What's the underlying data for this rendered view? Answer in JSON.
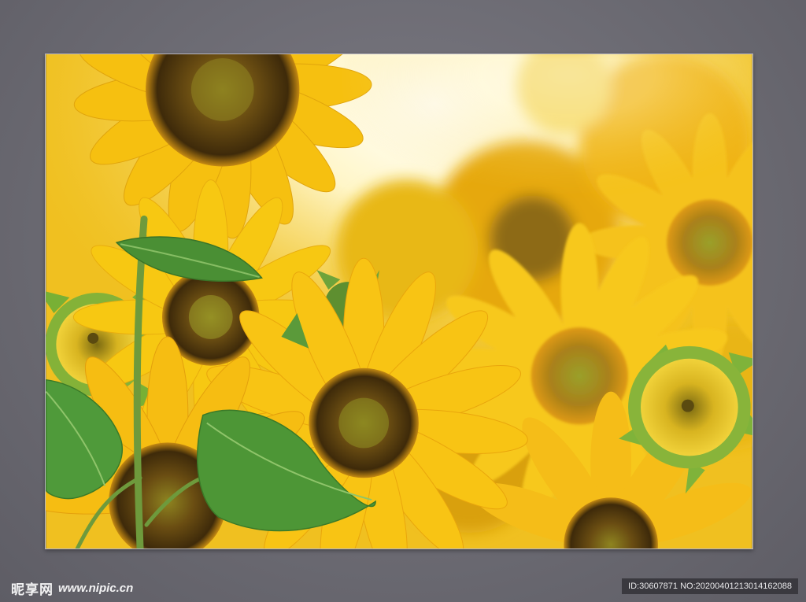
{
  "scene": {
    "subject": "sunflower-field-photo",
    "colors": {
      "background": "#6c6b73",
      "petal": "#f5c61a",
      "petal_deep": "#f0a80c",
      "seed_disc": "#6b4a12",
      "seed_center": "#8d7a20",
      "leaf": "#4f9a3a",
      "sky_glow": "#ffffff"
    }
  },
  "watermark": {
    "logo_text": "昵享网",
    "site_url": "www.nipic.cn",
    "id_text": "ID:30607871 NO:20200401213014162088"
  }
}
